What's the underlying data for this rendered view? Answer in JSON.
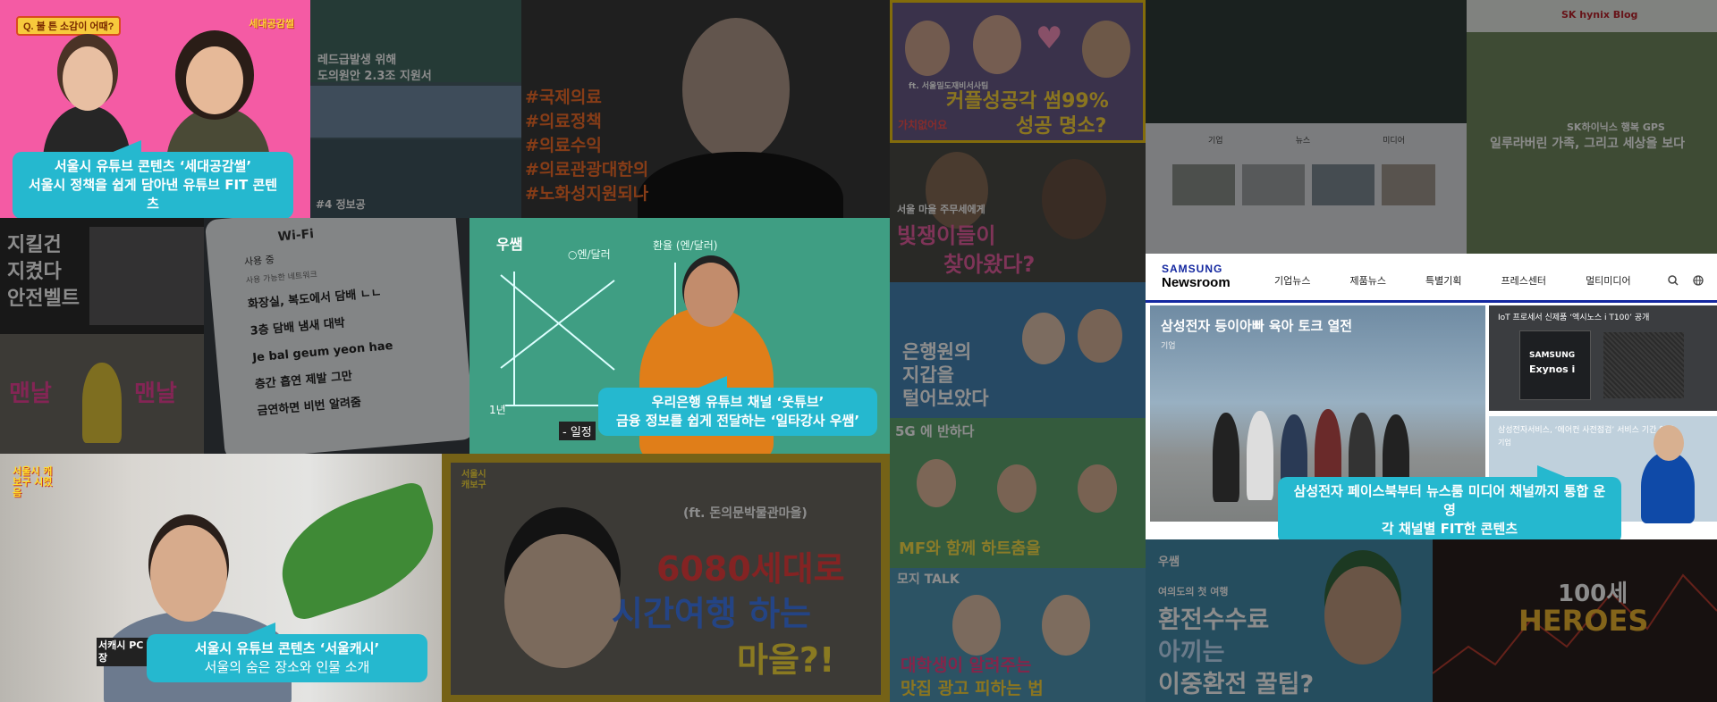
{
  "tiles": {
    "seoul_generation": {
      "badge": "Q. 불 튼 소감이 어때?",
      "logo": "세대공감썰",
      "callout_line1": "서울시 유튜브 콘텐츠 ‘세대공감썰’",
      "callout_line2": "서울시 정책을 쉽게 담아낸 유튜브 FIT 콘텐츠"
    },
    "news_collage": {
      "line1": "레드급발생 위해",
      "line2": "도의원안 2.3조 지원서",
      "tag": "#4 정보공"
    },
    "hashtag_man": {
      "tags": [
        "#국제의료",
        "#의료정책",
        "#의료수익",
        "#의료관광대한의",
        "#노화성지원되나"
      ]
    },
    "couple": {
      "line1": "커플성공각 썸99%",
      "line2": "성공 명소?",
      "tag": "ft. 서울밀도재비서사팀",
      "badge": "가치없어요"
    },
    "sk_blog": {
      "logo": "SK hynix Blog",
      "caption": "SK하이닉스 행복 GPS",
      "subtitle": "일루라버린 가족, 그리고 세상을 보다"
    },
    "tech_site": {
      "tabs": [
        "기업",
        "뉴스",
        "미디어"
      ]
    },
    "seatbelt": {
      "line1": "지킬건",
      "line2": "지켰다",
      "line3": "안전벨트"
    },
    "wifi": {
      "header": "Wi-Fi",
      "toggle_label": "사용 중",
      "section": "사용 가능한 네트워크",
      "networks": [
        "화장실, 복도에서 담배 ㄴㄴ",
        "3층 담배 냄새 대박",
        "Je bal geum yeon hae",
        "층간 흡연 제발 그만",
        "금연하면 비번 알려줌"
      ]
    },
    "woori": {
      "logo": "우쌤",
      "graph_label_left": "○엔/달러",
      "graph_label_right": "환율 (엔/달러)",
      "graph_year": "1년",
      "subtitle": "- 일정",
      "callout_line1": "우리은행 유튜브 채널 ‘웃튜브’",
      "callout_line2": "금융 정보를 쉽게 전달하는 ‘일타강사 우쌤’"
    },
    "busan": {
      "line1": "서울 마을 주무세에게",
      "line2": "빛쟁이들이",
      "line3": "찾아왔다?"
    },
    "banker": {
      "line1": "은행원의",
      "line2": "지갑을",
      "line3": "털어보았다"
    },
    "running_kid": {
      "left": "맨날",
      "right": "맨날"
    },
    "fiveg": {
      "title": "5G 에 반하다",
      "caption": "MF와 함께 하트춤을"
    },
    "mozzi": {
      "title": "모지 TALK",
      "line1": "대학생이 알려주는",
      "line2": "맛집 광고 피하는 법"
    },
    "seoul_cache": {
      "logo": "서울시 캐보구 시켰음",
      "sign": "서캐시 PC 정장",
      "callout_line1": "서울시 유튜브 콘텐츠 ‘서울캐시’",
      "callout_line2": "서울의 숨은 장소와 인물 소개"
    },
    "timetravel": {
      "logo": "서울시 캐보구",
      "tag": "(ft. 돈의문박물관마을)",
      "line1": "6080세대로",
      "line2": "시간여행 하는",
      "line3": "마을?!"
    },
    "exchange": {
      "badge": "우쌤",
      "tag": "여의도의 첫 여행",
      "line1": "환전수수료",
      "line2": "아끼는",
      "line3": "이중환전 꿀팁?"
    },
    "heroes": {
      "line1": "100세",
      "line2": "HEROES"
    }
  },
  "newsroom": {
    "brand": "SAMSUNG",
    "name": "Newsroom",
    "nav": [
      "기업뉴스",
      "제품뉴스",
      "특별기획",
      "프레스센터",
      "멀티미디어"
    ],
    "hero_title": "삼성전자 등이아빠 육아 토크 열전",
    "hero_tag": "기업",
    "side1_title": "IoT 프로세서 신제품 ‘엑시노스 i T100’ 공개",
    "side1_brand": "SAMSUNG",
    "side1_product": "Exynos i",
    "side2_title": "삼성전자서비스, ‘에어컨 사전점검’ 서비스 기간 연장",
    "side2_tag": "기업",
    "callout_line1": "삼성전자 페이스북부터 뉴스룸 미디어 채널까지 통합 운영",
    "callout_line2": "각 채널별 FIT한 콘텐츠"
  }
}
